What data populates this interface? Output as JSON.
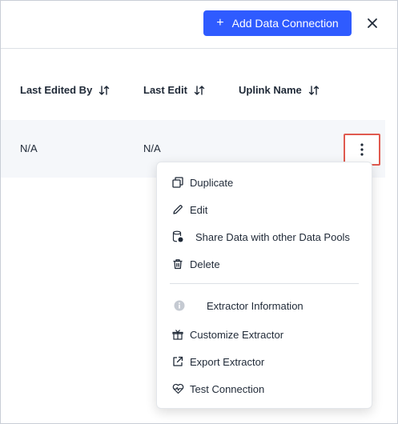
{
  "header": {
    "add_button_label": "Add Data Connection",
    "add_button_icon": "+",
    "close_icon": "close-icon"
  },
  "table": {
    "columns": [
      {
        "label": "Last Edited By"
      },
      {
        "label": "Last Edit"
      },
      {
        "label": "Uplink Name"
      }
    ],
    "rows": [
      {
        "last_edited_by": "N/A",
        "last_edit": "N/A"
      }
    ]
  },
  "menu": {
    "items": [
      {
        "label": "Duplicate",
        "icon": "duplicate-icon"
      },
      {
        "label": "Edit",
        "icon": "pencil-icon"
      },
      {
        "label": "Share Data with other Data Pools",
        "icon": "share-data-icon"
      },
      {
        "label": "Delete",
        "icon": "trash-icon"
      },
      {
        "label": "Extractor Information",
        "icon": "info-icon"
      },
      {
        "label": "Customize Extractor",
        "icon": "customize-icon"
      },
      {
        "label": "Export Extractor",
        "icon": "export-icon"
      },
      {
        "label": "Test Connection",
        "icon": "heartbeat-icon"
      }
    ]
  },
  "colors": {
    "primary": "#2f5bff",
    "highlight_border": "#e05a4f",
    "row_background": "#f5f7fa"
  }
}
